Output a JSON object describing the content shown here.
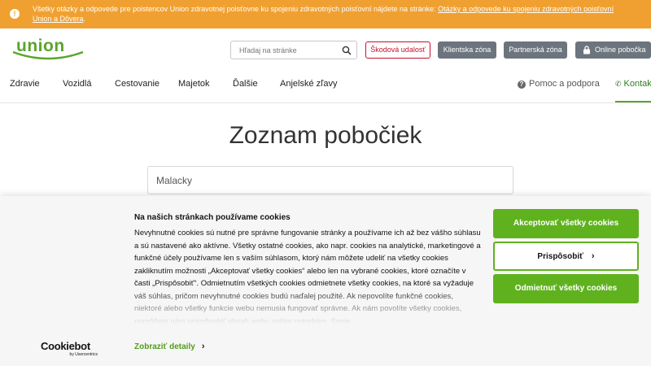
{
  "infobar": {
    "icon": "info-icon",
    "text": "Všetky otázky a odpovede pre poistencov Union zdravotnej poisťovne ku spojeniu zdravotných poisťovní nájdete na stránke: ",
    "link": "Otázky a odpovede ku spojeniu zdravotných poisťovní Union a Dôvera",
    "suffix": ".",
    "color": "#f0a030"
  },
  "header": {
    "logo_text": "union",
    "search_placeholder": "Hľadaj na stránke",
    "buttons": {
      "claim": "Škodová udalosť",
      "client": "Klientska zóna",
      "partner": "Partnerská zóna",
      "online": "Online pobočka"
    }
  },
  "nav": {
    "items": [
      "Zdravie",
      "Vozidlá",
      "Cestovanie",
      "Majetok",
      "Ďalšie",
      "Anjelské zľavy"
    ],
    "help": "Pomoc a podpora",
    "contact": "Kontakt"
  },
  "main": {
    "title": "Zoznam pobočiek",
    "branch_value": "Malacky"
  },
  "cookie": {
    "title": "Na našich stránkach používame cookies",
    "text": "Nevyhnutné cookies sú nutné pre správne fungovanie stránky a používame ich až bez vášho súhlasu a sú nastavené ako aktívne. Všetky ostatné cookies, ako napr. cookies na analytické, marketingové a funkčné účely používame len s vaším súhlasom, ktorý nám môžete udeliť na všetky cookies zakliknutím možnosti „Akceptovať všetky cookies“ alebo len na vybrané cookies, ktoré označíte v časti „Prispôsobiť“. Odmietnutím všetkých cookies odmietnete všetky cookies, na ktoré sa vyžaduje váš súhlas, pričom nevyhnutné cookies budú naďalej použité. Ak nepovolíte funkčné cookies, niektoré alebo všetky funkcie webu nemusia fungovať správne. Ak nám povolíte všetky cookies, pomôžete nám prispôsobiť obsah webu vašim potrebám. Svoje",
    "logo_name": "Cookiebot",
    "logo_sub": "by Usercentrics",
    "details": "Zobraziť detaily",
    "accept": "Akceptovať všetky cookies",
    "customize": "Prispôsobiť",
    "reject": "Odmietnuť všetky cookies",
    "accent": "#5fb21e"
  }
}
